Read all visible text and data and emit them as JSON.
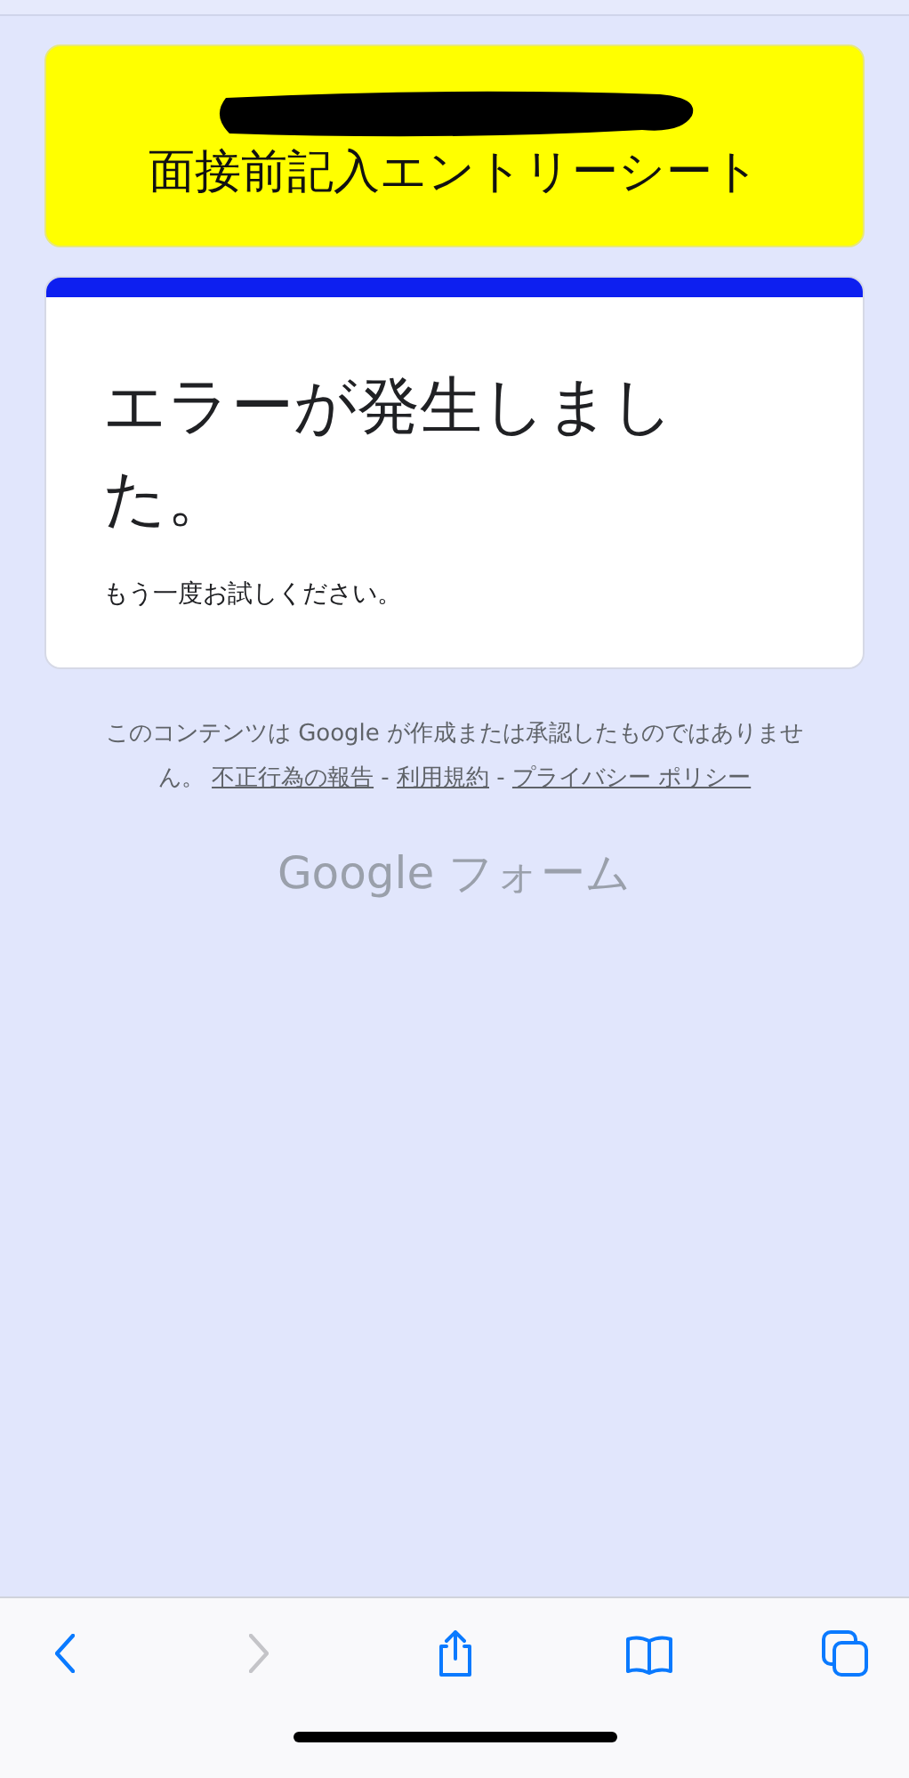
{
  "form_header": {
    "title": "面接前記入エントリーシート"
  },
  "error_card": {
    "heading": "エラーが発生しました。",
    "message": "もう一度お試しください。"
  },
  "footer": {
    "disclaimer": "このコンテンツは Google が作成または承認したものではありません。",
    "links": [
      {
        "label": "不正行為の報告"
      },
      {
        "label": "利用規約"
      },
      {
        "label": "プライバシー ポリシー"
      }
    ],
    "separator": "-",
    "logo": "Google フォーム"
  },
  "browser_toolbar": {
    "buttons": [
      {
        "kind": "back",
        "disabled": false
      },
      {
        "kind": "forward",
        "disabled": true
      },
      {
        "kind": "share",
        "disabled": false
      },
      {
        "kind": "bookmarks",
        "disabled": false
      },
      {
        "kind": "tabs",
        "disabled": false
      }
    ]
  }
}
